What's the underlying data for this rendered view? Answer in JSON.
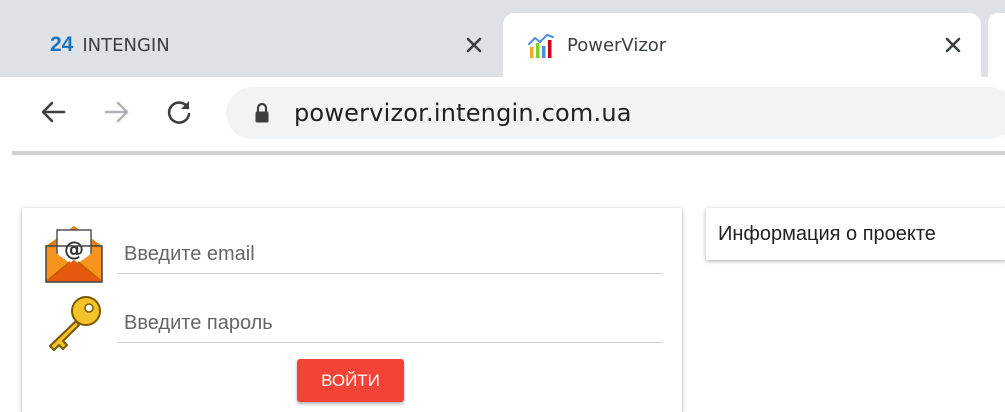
{
  "tabs": [
    {
      "favicon_text": "24",
      "title": "INTENGIN",
      "close_icon": "close-icon"
    },
    {
      "favicon": "powervizor-logo-icon",
      "title": "PowerVizor",
      "close_icon": "close-icon"
    }
  ],
  "toolbar": {
    "back_icon": "back-arrow-icon",
    "forward_icon": "forward-arrow-icon",
    "reload_icon": "reload-icon",
    "lock_icon": "lock-icon",
    "url": "powervizor.intengin.com.ua"
  },
  "login": {
    "email_icon": "email-envelope-icon",
    "email_placeholder": "Введите email",
    "email_value": "",
    "password_icon": "key-icon",
    "password_placeholder": "Введите пароль",
    "password_value": "",
    "submit_label": "ВОЙТИ",
    "submit_color": "#f44336"
  },
  "info": {
    "label": "Информация о проекте"
  },
  "colors": {
    "tabstrip_bg": "#dee1e6",
    "omnibox_bg": "#f1f3f4",
    "brand_blue": "#1c75bc"
  }
}
